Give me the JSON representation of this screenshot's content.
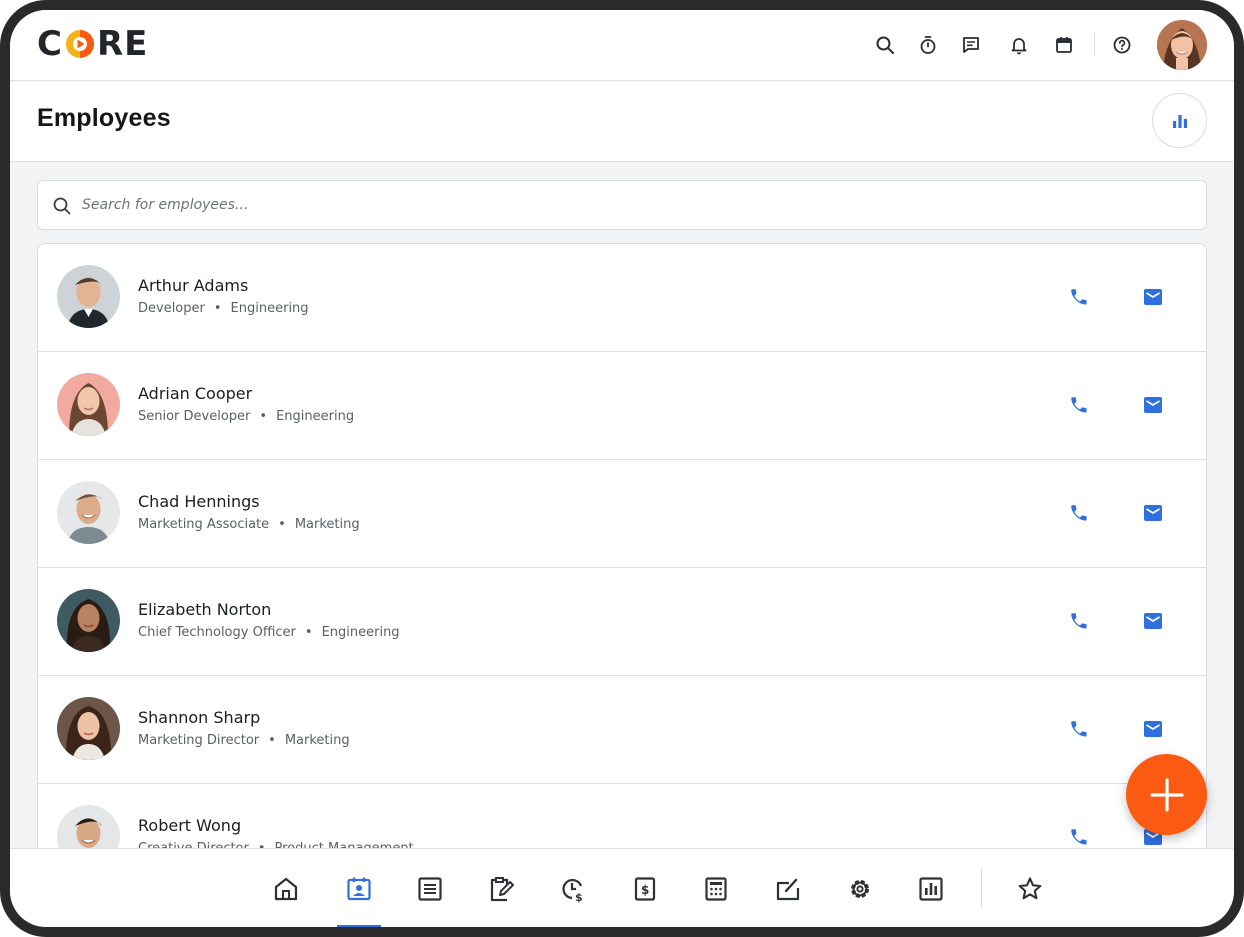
{
  "app": {
    "logo_left": "C",
    "logo_right": "RE",
    "brand_colors": {
      "orange": "#fb5a13",
      "yellow": "#f6b21a",
      "dark": "#22262b"
    }
  },
  "topbar": {
    "icons": [
      "search-icon",
      "stopwatch-icon",
      "messages-icon",
      "bell-icon",
      "calendar-icon",
      "help-icon"
    ],
    "avatar": "user-avatar"
  },
  "header": {
    "title": "Employees",
    "stats_icon": "bar-chart-icon"
  },
  "search": {
    "placeholder": "Search for employees..."
  },
  "employees": [
    {
      "name": "Arthur Adams",
      "role": "Developer",
      "department": "Engineering"
    },
    {
      "name": "Adrian Cooper",
      "role": "Senior Developer",
      "department": "Engineering"
    },
    {
      "name": "Chad Hennings",
      "role": "Marketing Associate",
      "department": "Marketing"
    },
    {
      "name": "Elizabeth Norton",
      "role": "Chief Technology Officer",
      "department": "Engineering"
    },
    {
      "name": "Shannon Sharp",
      "role": "Marketing Director",
      "department": "Marketing"
    },
    {
      "name": "Robert Wong",
      "role": "Creative Director",
      "department": "Product Management"
    }
  ],
  "separator": "•",
  "accent_color": "#2f6fde",
  "bottom_nav": {
    "items": [
      "home-icon",
      "employees-icon",
      "list-icon",
      "clipboard-edit-icon",
      "time-money-icon",
      "document-dollar-icon",
      "calculator-icon",
      "board-icon",
      "settings-icon",
      "report-icon",
      "star-icon"
    ],
    "active": "employees-icon"
  }
}
